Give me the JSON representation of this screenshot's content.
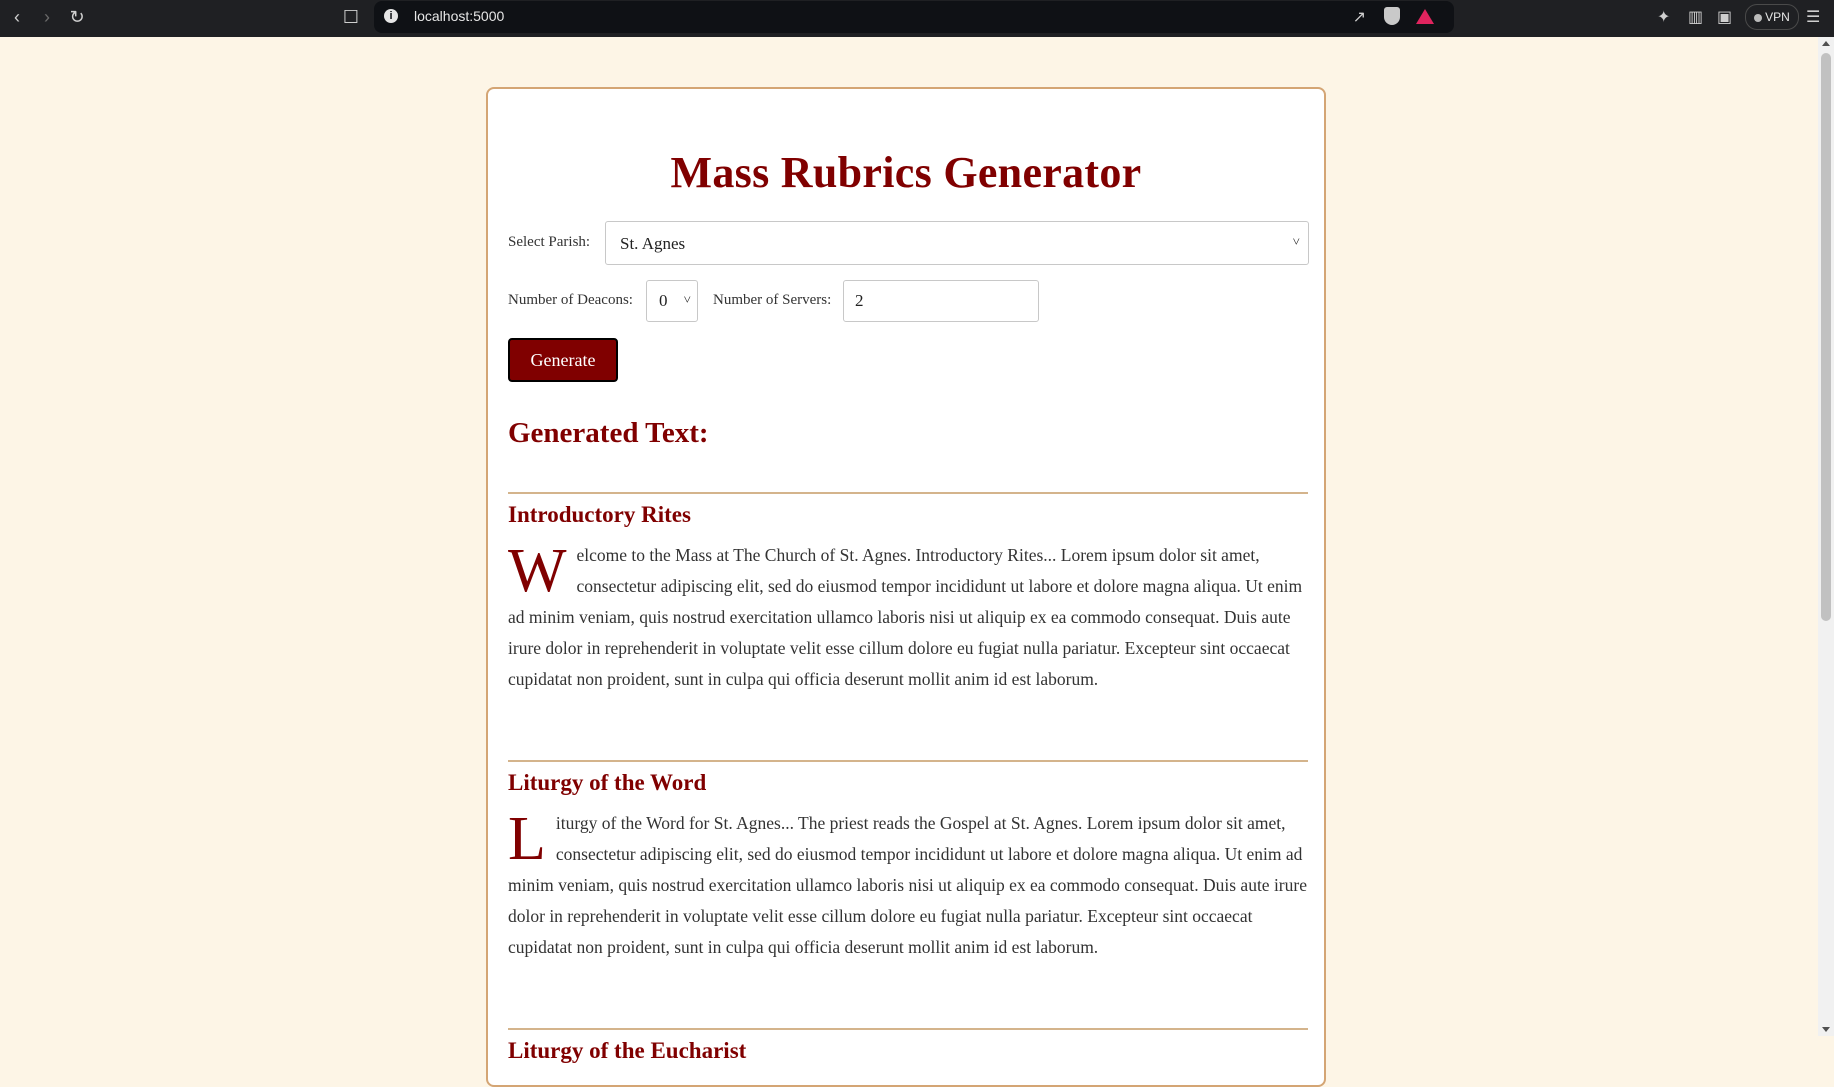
{
  "browser": {
    "url": "localhost:5000",
    "vpn_label": "VPN"
  },
  "app": {
    "title": "Mass Rubrics Generator",
    "parish_label": "Select Parish:",
    "parish_value": "St. Agnes",
    "deacons_label": "Number of Deacons:",
    "deacons_value": "0",
    "servers_label": "Number of Servers:",
    "servers_value": "2",
    "generate_label": "Generate",
    "generated_heading": "Generated Text:"
  },
  "sections": [
    {
      "title": "Introductory Rites",
      "dropcap": "W",
      "body": "elcome to the Mass at The Church of St. Agnes. Introductory Rites... Lorem ipsum dolor sit amet, consectetur adipiscing elit, sed do eiusmod tempor incididunt ut labore et dolore magna aliqua. Ut enim ad minim veniam, quis nostrud exercitation ullamco laboris nisi ut aliquip ex ea commodo consequat. Duis aute irure dolor in reprehenderit in voluptate velit esse cillum dolore eu fugiat nulla pariatur. Excepteur sint occaecat cupidatat non proident, sunt in culpa qui officia deserunt mollit anim id est laborum."
    },
    {
      "title": "Liturgy of the Word",
      "dropcap": "L",
      "body": "iturgy of the Word for St. Agnes... The priest reads the Gospel at St. Agnes. Lorem ipsum dolor sit amet, consectetur adipiscing elit, sed do eiusmod tempor incididunt ut labore et dolore magna aliqua. Ut enim ad minim veniam, quis nostrud exercitation ullamco laboris nisi ut aliquip ex ea commodo consequat. Duis aute irure dolor in reprehenderit in voluptate velit esse cillum dolore eu fugiat nulla pariatur. Excepteur sint occaecat cupidatat non proident, sunt in culpa qui officia deserunt mollit anim id est laborum."
    },
    {
      "title": "Liturgy of the Eucharist"
    }
  ]
}
